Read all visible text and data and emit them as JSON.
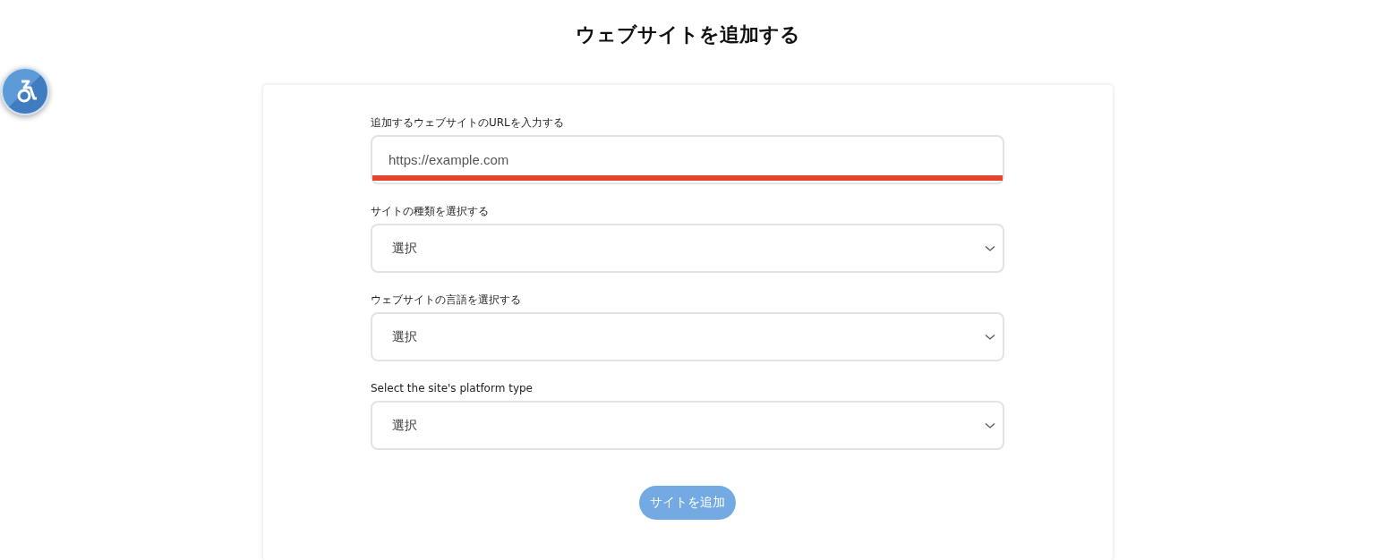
{
  "page_title": "ウェブサイトを追加する",
  "fields": [
    {
      "kind": "text",
      "label": "追加するウェブサイトのURLを入力する",
      "placeholder": "https://example.com",
      "highlighted": true
    },
    {
      "kind": "select",
      "label": "サイトの種類を選択する",
      "value": "選択"
    },
    {
      "kind": "select",
      "label": "ウェブサイトの言語を選択する",
      "value": "選択"
    },
    {
      "kind": "select",
      "label": "Select the site's platform type",
      "value": "選択"
    }
  ],
  "submit_button": {
    "label": "サイトを追加",
    "disabled": true
  }
}
